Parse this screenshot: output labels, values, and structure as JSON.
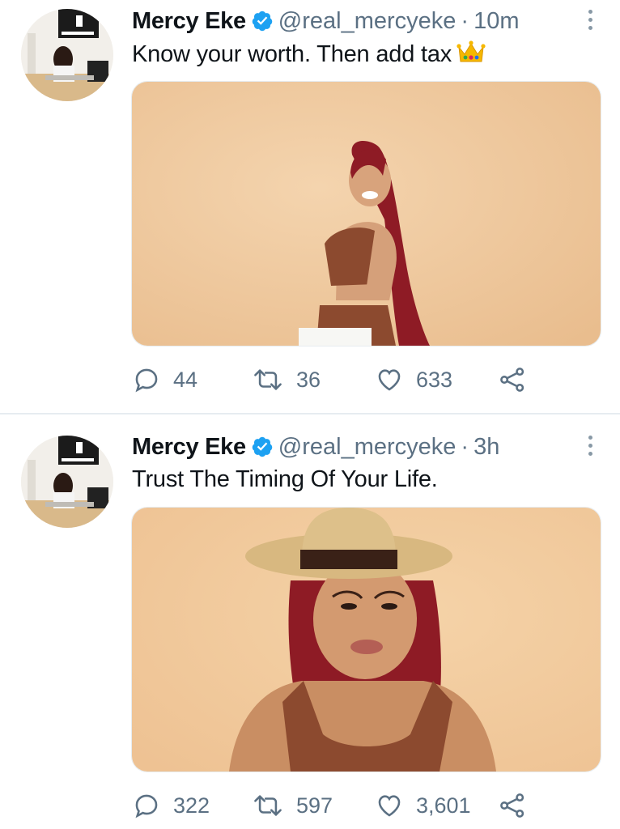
{
  "tweets": [
    {
      "author": {
        "name": "Mercy Eke",
        "handle": "@real_mercyeke",
        "verified": true,
        "avatar_icon": "avatar-photo"
      },
      "separator": "·",
      "time": "10m",
      "text": "Know your worth. Then add tax",
      "emoji_icon": "crown-icon",
      "media": {
        "description_icon": "photo"
      },
      "counts": {
        "replies": "44",
        "retweets": "36",
        "likes": "633"
      }
    },
    {
      "author": {
        "name": "Mercy Eke",
        "handle": "@real_mercyeke",
        "verified": true,
        "avatar_icon": "avatar-photo"
      },
      "separator": "·",
      "time": "3h",
      "text": "Trust The Timing Of Your Life.",
      "media": {
        "description_icon": "photo"
      },
      "counts": {
        "replies": "322",
        "retweets": "597",
        "likes": "3,601"
      }
    }
  ],
  "colors": {
    "verified": "#1da1f2",
    "muted": "#5b7083",
    "photo_bg": "#efc9a0",
    "hair": "#8e1b25"
  }
}
